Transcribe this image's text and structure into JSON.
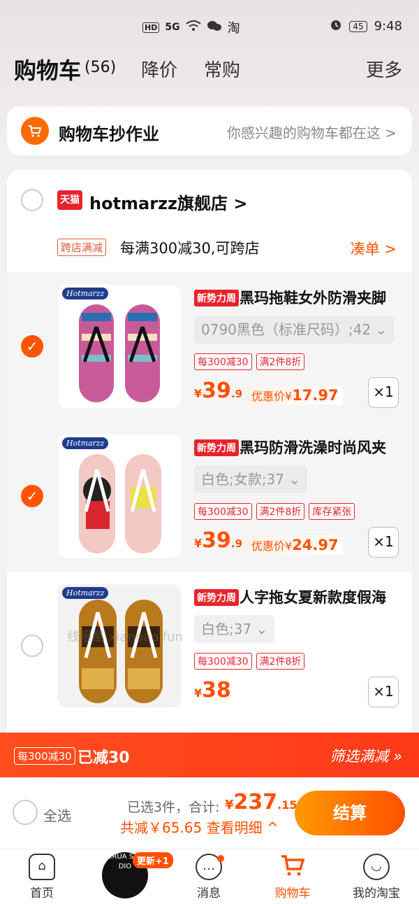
{
  "status": {
    "hd": "HD",
    "signal": "5G",
    "carrier_icon": "淘",
    "battery": "45",
    "time": "9:48"
  },
  "header": {
    "title": "购物车",
    "count": "(56)",
    "tab_discount": "降价",
    "tab_frequent": "常购",
    "more": "更多"
  },
  "homework": {
    "title": "购物车抄作业",
    "subtitle": "你感兴趣的购物车都在这 >"
  },
  "store": {
    "tmall_badge": "天猫",
    "name": "hotmarzz旗舰店 >",
    "promo_tag": "跨店满减",
    "promo_text": "每满300减30,可跨店",
    "promo_link": "凑单 >"
  },
  "items": [
    {
      "brand": "Hotmarzz",
      "tag": "新势力周",
      "name": "黑玛拖鞋女外防滑夹脚",
      "sku": "0790黑色（标准尺码）;42 ⌄",
      "tags": [
        "每300减30",
        "满2件8折"
      ],
      "price_int": "39",
      "price_dec": ".9",
      "disc_label": "优惠价¥",
      "disc_price": "17.97",
      "qty": "×1",
      "checked": true
    },
    {
      "brand": "Hotmarzz",
      "tag": "新势力周",
      "name": "黑玛防滑洗澡时尚风夹",
      "sku": "白色;女款;37 ⌄",
      "tags": [
        "每300减30",
        "满2件8折",
        "库存紧张"
      ],
      "price_int": "39",
      "price_dec": ".9",
      "disc_label": "优惠价¥",
      "disc_price": "24.97",
      "qty": "×1",
      "checked": true
    },
    {
      "brand": "Hotmarzz",
      "tag": "新势力周",
      "name": "人字拖女夏新款度假海",
      "sku": "白色;37 ⌄",
      "tags": [
        "每300减30",
        "满2件8折"
      ],
      "price_int": "38",
      "price_dec": "",
      "disc_label": "",
      "disc_price": "",
      "qty": "×1",
      "checked": false
    }
  ],
  "watermark": "线报酷 xianbao.fun",
  "banner": {
    "tag": "每300减30",
    "saved": "已减30",
    "link": "筛选满减 »"
  },
  "checkout": {
    "select_all": "全选",
    "selected": "已选3件，合计:",
    "total_int": "237",
    "total_dec": ".15",
    "saved": "共减￥65.65 查看明细 ^",
    "button": "结算"
  },
  "tabbar": {
    "home": "首页",
    "update": "更新+1",
    "messages": "消息",
    "cart": "购物车",
    "mine": "我的淘宝",
    "avatar_text": "CRUA STU DIO"
  },
  "colors": {
    "accent": "#ff5000",
    "tmall_red": "#e8232c"
  }
}
